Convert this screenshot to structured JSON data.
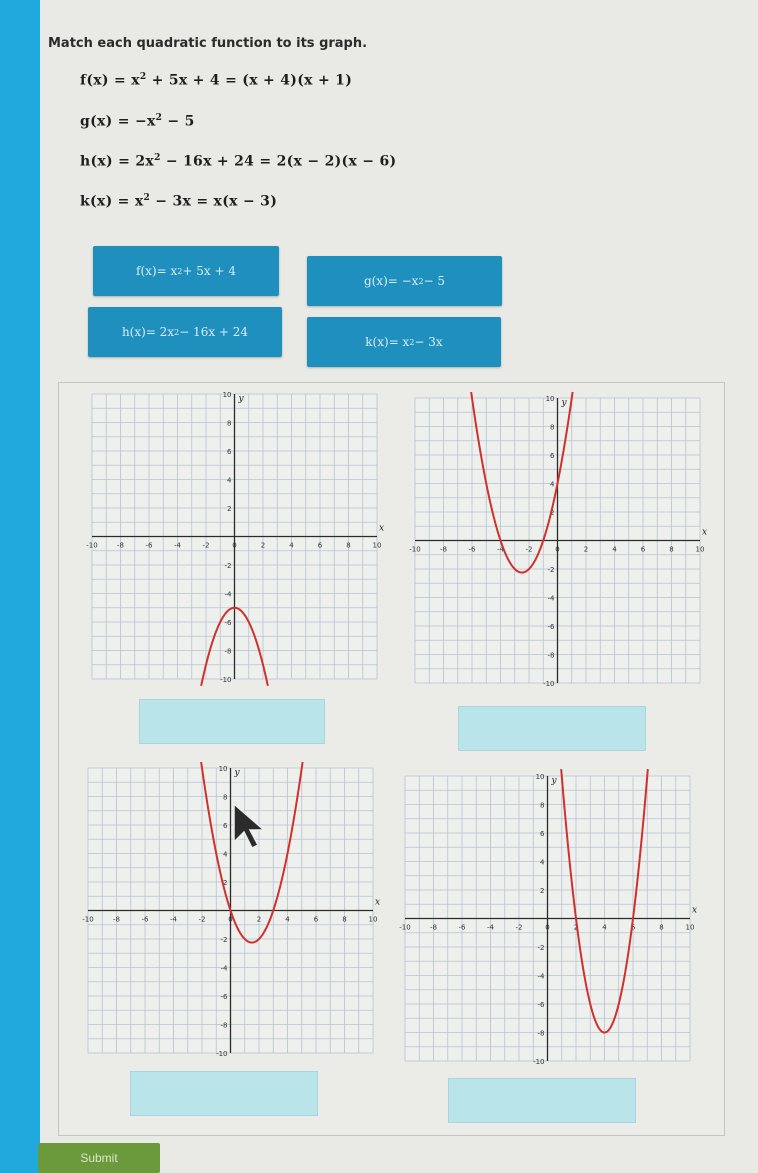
{
  "prompt": "Match each quadratic function to its graph.",
  "equations": [
    {
      "name": "f(x)",
      "rhs_a": "x",
      "exp_a": "2",
      "rhs_b": " + 5x + 4 = (x + 4)(x + 1)"
    },
    {
      "name": "g(x)",
      "rhs_a": "−x",
      "exp_a": "2",
      "rhs_b": " − 5"
    },
    {
      "name": "h(x)",
      "rhs_a": "2x",
      "exp_a": "2",
      "rhs_b": " − 16x + 24 = 2(x − 2)(x − 6)"
    },
    {
      "name": "k(x)",
      "rhs_a": "x",
      "exp_a": "2",
      "rhs_b": " − 3x = x(x − 3)"
    }
  ],
  "tiles": [
    {
      "name": "f(x)",
      "a": " = x",
      "exp": "2",
      "b": " + 5x + 4"
    },
    {
      "name": "g(x)",
      "a": " = −x",
      "exp": "2",
      "b": " − 5"
    },
    {
      "name": "h(x)",
      "a": " = 2x",
      "exp": "2",
      "b": " − 16x + 24"
    },
    {
      "name": "k(x)",
      "a": " = x",
      "exp": "2",
      "b": " − 3x"
    }
  ],
  "graph_axis": {
    "x_label": "x",
    "y_label": "y",
    "x_ticks": [
      "-10",
      "-8",
      "-6",
      "-4",
      "-2",
      "0",
      "2",
      "4",
      "6",
      "8",
      "10"
    ],
    "y_ticks": [
      "10",
      "8",
      "6",
      "4",
      "2",
      "-2",
      "-4",
      "-6",
      "-8",
      "-10"
    ]
  },
  "curve_color": "#d0312d",
  "submit_label": "Submit"
}
